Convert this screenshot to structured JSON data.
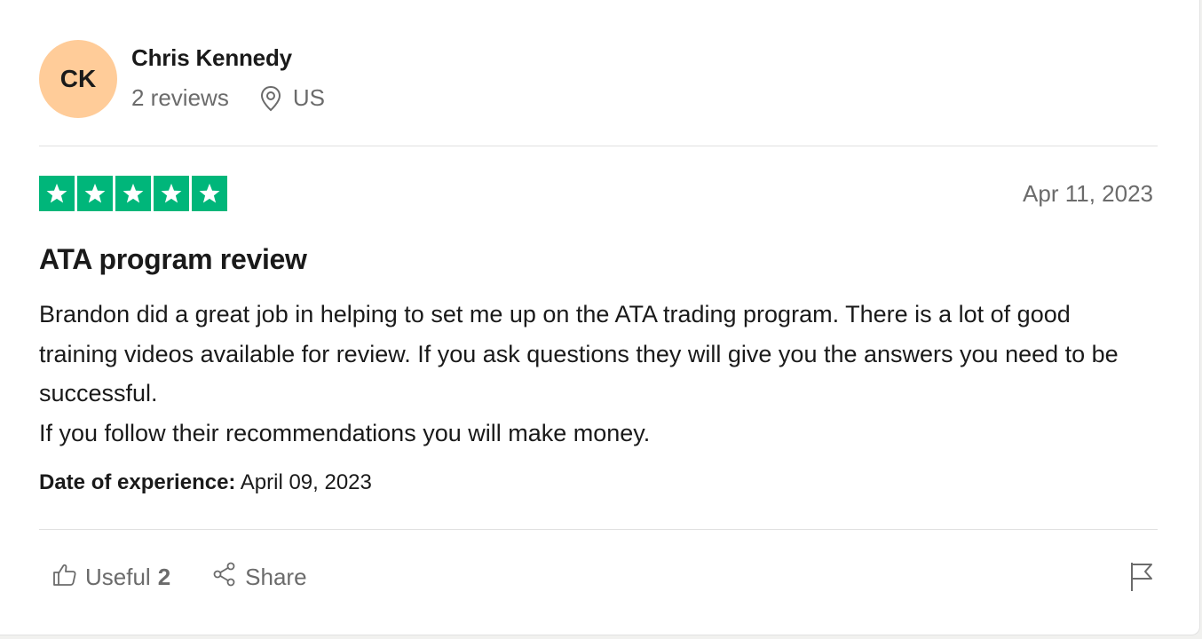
{
  "reviewer": {
    "initials": "CK",
    "name": "Chris Kennedy",
    "review_count": "2 reviews",
    "country": "US",
    "avatar_color": "#ffcc99"
  },
  "review": {
    "rating": 5,
    "max_rating": 5,
    "star_color": "#00b67a",
    "date": "Apr 11, 2023",
    "title": "ATA program review",
    "body_lines": [
      "Brandon did a great job in helping to set me up on the ATA trading program. There is a lot of good training videos available for review. If you ask questions they will give you the answers you need to be successful.",
      "If you follow their recommendations you will make money."
    ],
    "experience_label": "Date of experience:",
    "experience_date": "April 09, 2023"
  },
  "actions": {
    "useful_label": "Useful",
    "useful_count": "2",
    "share_label": "Share",
    "icons": [
      "thumbs-up-icon",
      "share-icon",
      "flag-icon",
      "location-pin-icon",
      "star-icon"
    ]
  }
}
